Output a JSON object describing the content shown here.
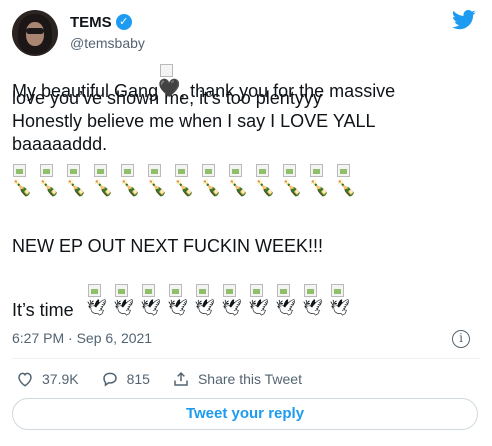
{
  "author": {
    "display_name": "TEMS",
    "handle": "@temsbaby",
    "verified": true
  },
  "tweet": {
    "line1_before": "My beautiful Gang",
    "line1_after": ", thank you for the massive",
    "line2": "love you’ve shown me, it’s too plentyyy",
    "line3": "Honestly believe me when I say I LOVE YALL",
    "line4": "baaaaaddd.",
    "heart_emoji": "🖤",
    "champagne_emoji": "🍾",
    "champagne_count": 13,
    "ep_line": "NEW EP OUT NEXT FUCKIN WEEK!!!",
    "time_label": "It’s time",
    "dove_emoji": "🕊",
    "dove_count": 10
  },
  "meta": {
    "timestamp": "6:27 PM · Sep 6, 2021"
  },
  "actions": {
    "likes": "37.9K",
    "replies": "815",
    "share_label": "Share this Tweet"
  },
  "reply_button_label": "Tweet your reply",
  "colors": {
    "accent": "#1d9bf0",
    "secondary_text": "#536471",
    "border": "#cfd9de"
  }
}
